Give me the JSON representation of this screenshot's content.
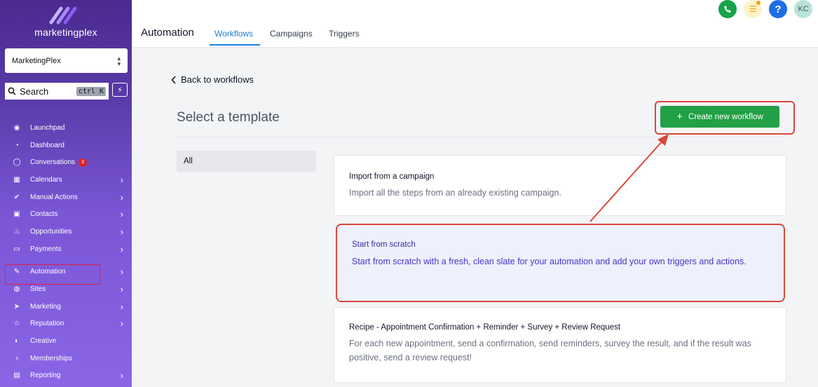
{
  "brand": {
    "name": "marketingplex"
  },
  "account": {
    "name": "MarketingPlex"
  },
  "search": {
    "label": "Search",
    "shortcut": "ctrl K"
  },
  "nav": [
    {
      "label": "Launchpad",
      "icon": "rocket-icon",
      "arrow": false
    },
    {
      "label": "Dashboard",
      "icon": "gauge-icon",
      "arrow": false
    },
    {
      "label": "Conversations",
      "icon": "chat-icon",
      "arrow": false,
      "badge": "3"
    },
    {
      "label": "Calendars",
      "icon": "calendar-icon",
      "arrow": true
    },
    {
      "label": "Manual Actions",
      "icon": "check-circle-icon",
      "arrow": true
    },
    {
      "label": "Contacts",
      "icon": "contacts-icon",
      "arrow": true
    },
    {
      "label": "Opportunities",
      "icon": "flame-icon",
      "arrow": true
    },
    {
      "label": "Payments",
      "icon": "card-icon",
      "arrow": true
    },
    {
      "label": "Automation",
      "icon": "wand-icon",
      "arrow": true
    },
    {
      "label": "Sites",
      "icon": "globe-icon",
      "arrow": true
    },
    {
      "label": "Marketing",
      "icon": "send-icon",
      "arrow": true
    },
    {
      "label": "Reputation",
      "icon": "star-icon",
      "arrow": true
    },
    {
      "label": "Creative",
      "icon": "palette-icon",
      "arrow": false
    },
    {
      "label": "Memberships",
      "icon": "badge-icon",
      "arrow": false
    },
    {
      "label": "Reporting",
      "icon": "chart-icon",
      "arrow": true
    }
  ],
  "header": {
    "title": "Automation",
    "tabs": [
      "Workflows",
      "Campaigns",
      "Triggers"
    ],
    "avatar": "KC"
  },
  "main": {
    "back": "Back to workflows",
    "page_title": "Select a template",
    "create_button": "Create new workflow",
    "filter": "All",
    "cards": [
      {
        "title": "Import from a campaign",
        "desc": "Import all the steps from an already existing campaign."
      },
      {
        "title": "Start from scratch",
        "desc": "Start from scratch with a fresh, clean slate for your automation and add your own triggers and actions."
      },
      {
        "title": "Recipe - Appointment Confirmation + Reminder + Survey + Review Request",
        "desc": "For each new appointment, send a confirmation, send reminders, survey the result, and if the result was positive, send a review request!"
      }
    ]
  },
  "colors": {
    "accent": "#1d7fd6",
    "create": "#21a046",
    "annotation": "#d9483b"
  }
}
